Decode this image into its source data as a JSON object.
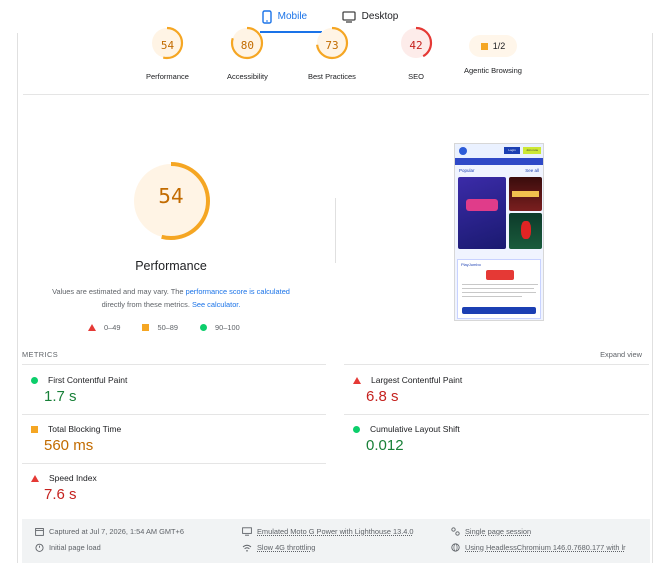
{
  "tabs": [
    {
      "label": "Mobile",
      "active": true,
      "icon": "mobile-icon"
    },
    {
      "label": "Desktop",
      "active": false,
      "icon": "desktop-icon"
    }
  ],
  "categories": [
    {
      "name": "performance",
      "label": "Performance",
      "score": "54",
      "value": 54,
      "color": "#f5a623"
    },
    {
      "name": "accessibility",
      "label": "Accessibility",
      "score": "80",
      "value": 80,
      "color": "#f5a623"
    },
    {
      "name": "best-practices",
      "label": "Best Practices",
      "score": "73",
      "value": 73,
      "color": "#f5a623"
    },
    {
      "name": "seo",
      "label": "SEO",
      "score": "42",
      "value": 42,
      "color": "#e53935"
    }
  ],
  "agentic": {
    "label": "Agentic Browsing",
    "score": "1/2"
  },
  "main": {
    "score": "54",
    "value": 54,
    "title": "Performance",
    "desc_prefix": "Values are estimated and may vary. The ",
    "desc_link1": "performance score is calculated",
    "desc_middle": " directly from these metrics. ",
    "desc_link2": "See calculator."
  },
  "legend": [
    {
      "label": "0–49",
      "shape": "triangle-red"
    },
    {
      "label": "50–89",
      "shape": "square-orange"
    },
    {
      "label": "90–100",
      "shape": "circle-green"
    }
  ],
  "thumbnail": {
    "login": "Login",
    "signup": "Join now",
    "popular": "Popular",
    "see_all": "See all",
    "modal_title": "PlayJumbo",
    "ok": "Okay"
  },
  "metrics": {
    "heading": "METRICS",
    "expand": "Expand view",
    "fcp": {
      "label": "First Contentful Paint",
      "value": "1.7 s"
    },
    "lcp": {
      "label": "Largest Contentful Paint",
      "value": "6.8 s"
    },
    "tbt": {
      "label": "Total Blocking Time",
      "value": "560 ms"
    },
    "cls": {
      "label": "Cumulative Layout Shift",
      "value": "0.012"
    },
    "si": {
      "label": "Speed Index",
      "value": "7.6 s"
    }
  },
  "footer": {
    "captured": "Captured at Jul 7, 2026, 1:54 AM GMT+6",
    "device": "Emulated Moto G Power with Lighthouse 13.4.0",
    "session": "Single page session",
    "load": "Initial page load",
    "throttle": "Slow 4G throttling",
    "browser": "Using HeadlessChromium 146.0.7680.177 with lr"
  }
}
